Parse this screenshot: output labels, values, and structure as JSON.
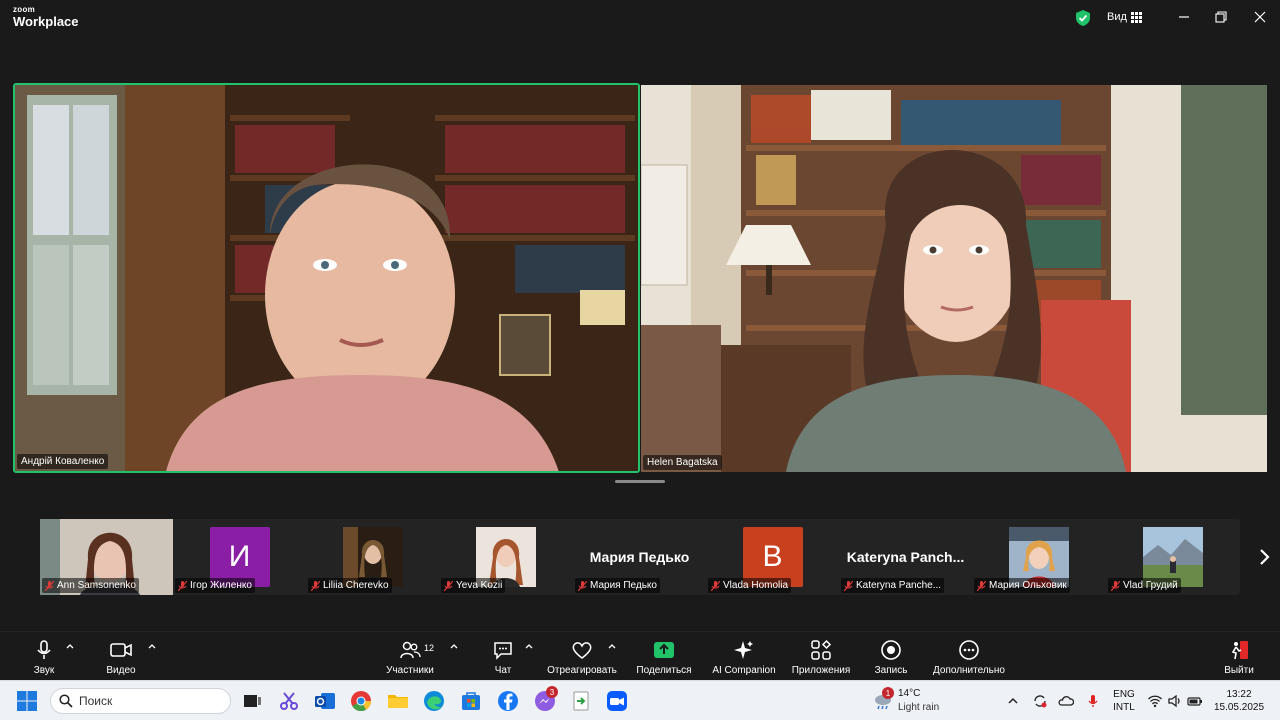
{
  "app": {
    "brand_small": "zoom",
    "brand_big": "Workplace",
    "view_label": "Вид"
  },
  "speakers": [
    {
      "name": "Андрій Коваленко"
    },
    {
      "name": "Helen Bagatska"
    }
  ],
  "gallery": [
    {
      "name": "Ann Samsonenko",
      "kind": "video"
    },
    {
      "name": "Ігор Жиленко",
      "kind": "avatar",
      "initial": "И",
      "color": "#8a1fa6"
    },
    {
      "name": "Liliia Cherevko",
      "kind": "video"
    },
    {
      "name": "Yeva Kozii",
      "kind": "video"
    },
    {
      "name": "Мария Педько",
      "kind": "name",
      "display": "Мария Педько"
    },
    {
      "name": "Vlada Homolia",
      "kind": "avatar",
      "initial": "B",
      "color": "#c9401e"
    },
    {
      "name": "Kateryna Panche...",
      "kind": "name",
      "display": "Kateryna  Panch..."
    },
    {
      "name": "Мария Ольховик",
      "kind": "video"
    },
    {
      "name": "Vlad Грудий",
      "kind": "video"
    }
  ],
  "toolbar": {
    "audio": "Звук",
    "video": "Видео",
    "participants": "Участники",
    "participants_count": "12",
    "chat": "Чат",
    "react": "Отреагировать",
    "share": "Поделиться",
    "ai": "AI Companion",
    "apps": "Приложения",
    "record": "Запись",
    "more": "Дополнительно",
    "leave": "Выйти"
  },
  "taskbar": {
    "search_placeholder": "Поиск",
    "messenger_badge": "3",
    "weather_badge": "1",
    "weather_temp": "14°C",
    "weather_desc": "Light rain",
    "lang_top": "ENG",
    "lang_bottom": "INTL",
    "time": "13:22",
    "date": "15.05.2025"
  },
  "colors": {
    "active_speaker_border": "#21c36a",
    "share_green": "#21c36a",
    "leave_red": "#e02828"
  }
}
